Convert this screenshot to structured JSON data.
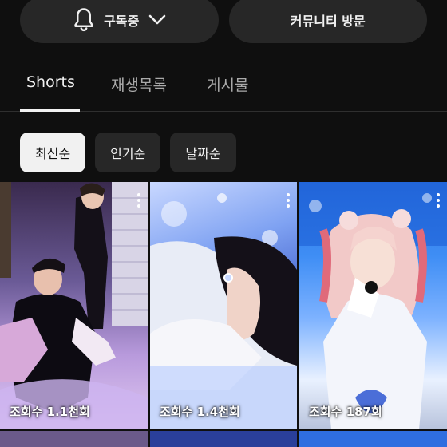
{
  "header": {
    "subscribe_label": "구독중",
    "community_label": "커뮤니티 방문"
  },
  "tabs": [
    {
      "label": "Shorts",
      "active": true
    },
    {
      "label": "재생목록",
      "active": false
    },
    {
      "label": "게시물",
      "active": false
    }
  ],
  "sort_chips": [
    {
      "label": "최신순",
      "selected": true
    },
    {
      "label": "인기순",
      "selected": false
    },
    {
      "label": "날짜순",
      "selected": false
    }
  ],
  "shorts": [
    {
      "views": "조회수 1.1천회"
    },
    {
      "views": "조회수 1.4천회"
    },
    {
      "views": "조회수 187회"
    }
  ],
  "colors": {
    "background": "#0f0f0f",
    "button_bg": "#272727",
    "chip_selected_bg": "#f1f1f1",
    "text_primary": "#f1f1f1",
    "text_secondary": "#aaaaaa"
  }
}
